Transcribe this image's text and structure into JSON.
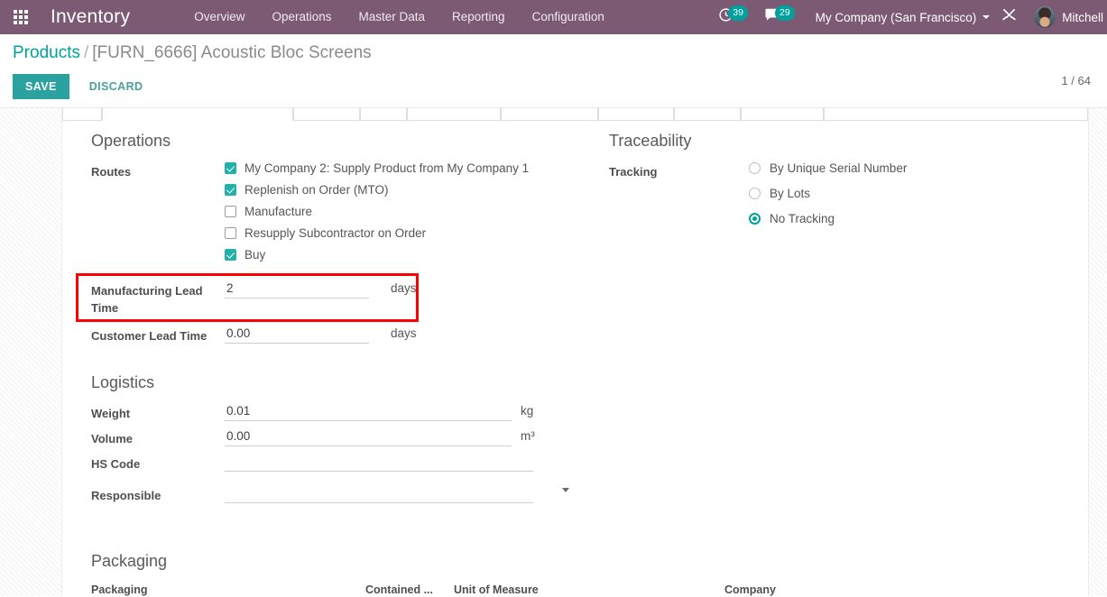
{
  "navbar": {
    "apps_icon": "apps-grid-icon",
    "brand": "Inventory",
    "menu": [
      {
        "label": "Overview"
      },
      {
        "label": "Operations"
      },
      {
        "label": "Master Data"
      },
      {
        "label": "Reporting"
      },
      {
        "label": "Configuration"
      }
    ],
    "systray": {
      "activities_icon": "clock-icon",
      "activities_count": "39",
      "messages_icon": "chat-bubble-icon",
      "messages_count": "29",
      "company": "My Company (San Francisco)",
      "debug_icon": "wrench-tools-icon",
      "user_name": "Mitchell",
      "avatar_icon": "user-avatar"
    },
    "accent_purple": "#7C5A74",
    "accent_teal": "#00A09D"
  },
  "control_panel": {
    "breadcrumb_root": "Products",
    "breadcrumb_sep": "/",
    "breadcrumb_current": "[FURN_6666] Acoustic Bloc Screens",
    "save_label": "SAVE",
    "discard_label": "DISCARD",
    "pager": "1 / 64"
  },
  "form": {
    "operations": {
      "title": "Operations",
      "routes_label": "Routes",
      "routes": [
        {
          "label": "My Company 2: Supply Product from My Company 1",
          "checked": true
        },
        {
          "label": "Replenish on Order (MTO)",
          "checked": true
        },
        {
          "label": "Manufacture",
          "checked": false
        },
        {
          "label": "Resupply Subcontractor on Order",
          "checked": false
        },
        {
          "label": "Buy",
          "checked": true
        }
      ],
      "manufacturing_lead_time_label": "Manufacturing Lead Time",
      "manufacturing_lead_time_value": "2",
      "manufacturing_lead_time_unit": "days",
      "customer_lead_time_label": "Customer Lead Time",
      "customer_lead_time_value": "0.00",
      "customer_lead_time_unit": "days",
      "highlight_color": "#ff0000"
    },
    "traceability": {
      "title": "Traceability",
      "tracking_label": "Tracking",
      "options": [
        {
          "label": "By Unique Serial Number",
          "selected": false
        },
        {
          "label": "By Lots",
          "selected": false
        },
        {
          "label": "No Tracking",
          "selected": true
        }
      ]
    },
    "logistics": {
      "title": "Logistics",
      "weight_label": "Weight",
      "weight_value": "0.01",
      "weight_unit": "kg",
      "volume_label": "Volume",
      "volume_value": "0.00",
      "volume_unit": "m³",
      "hs_code_label": "HS Code",
      "hs_code_value": "",
      "responsible_label": "Responsible",
      "responsible_value": ""
    },
    "packaging": {
      "title": "Packaging",
      "columns": [
        "Packaging",
        "Contained ...",
        "Unit of Measure",
        "Company"
      ]
    }
  }
}
